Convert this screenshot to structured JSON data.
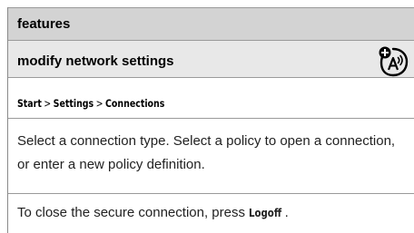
{
  "header": {
    "title": "features"
  },
  "feature": {
    "title": "modify network settings",
    "icon": "network-antenna-icon"
  },
  "path": {
    "start": "Start",
    "separator": ">",
    "settings": "Settings",
    "connections": "Connections"
  },
  "body": {
    "text": "Select a connection type. Select a policy to open a connection, or enter a new policy definition."
  },
  "closing": {
    "prefix": "To close the secure connection, press ",
    "key": "Logoff",
    "suffix": "."
  }
}
